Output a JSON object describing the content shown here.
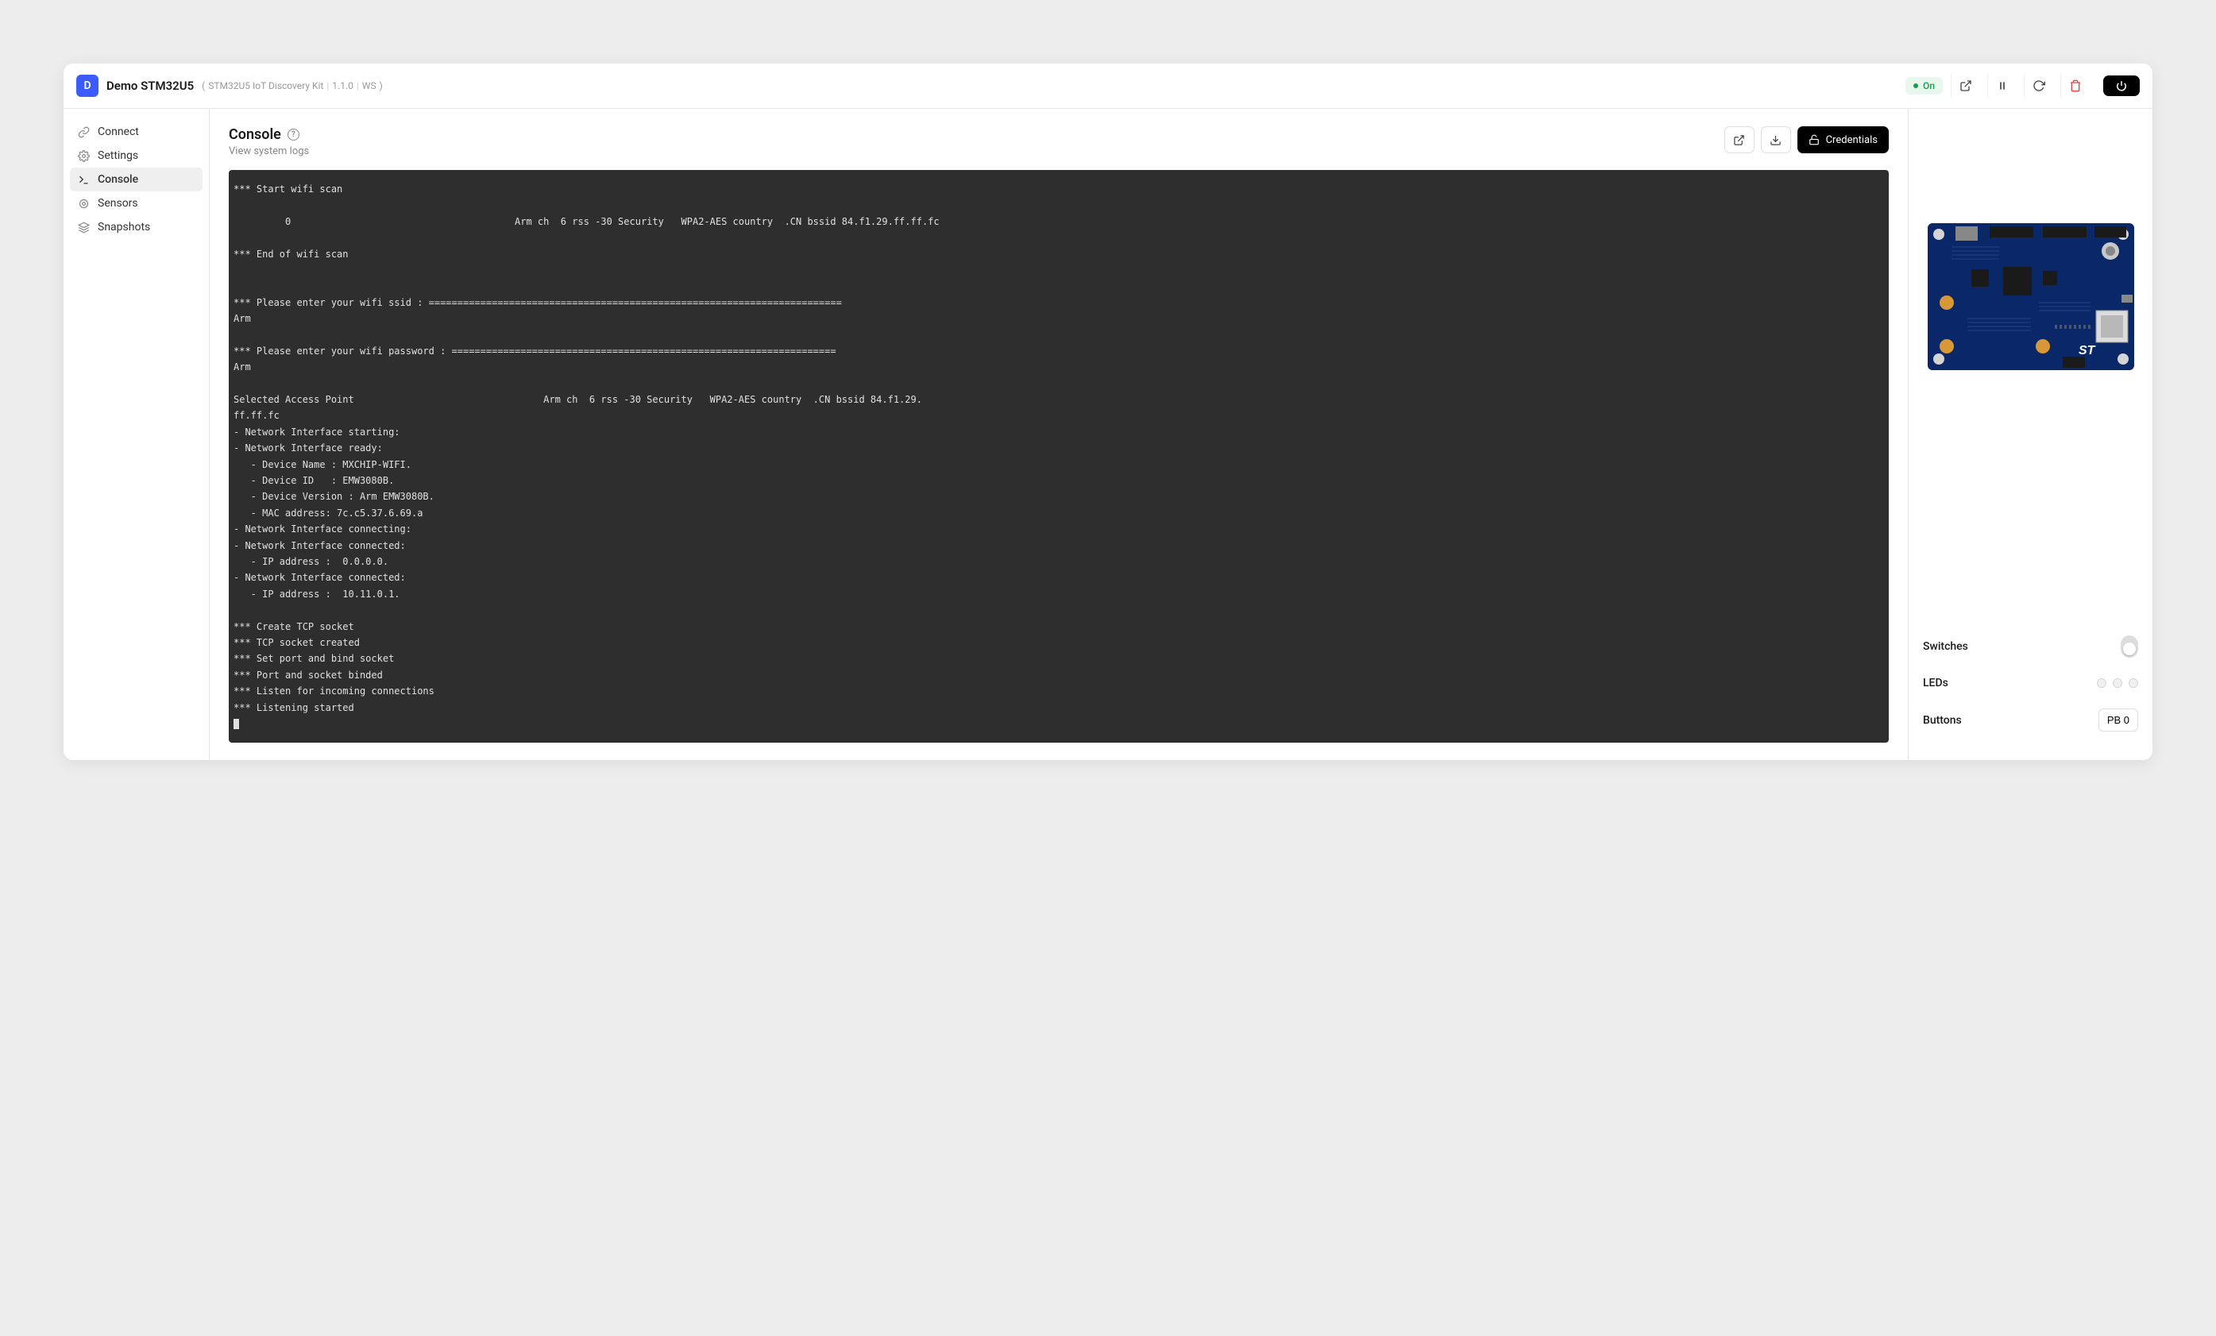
{
  "header": {
    "avatar_initial": "D",
    "title": "Demo STM32U5",
    "kit": "STM32U5 IoT Discovery Kit",
    "version": "1.1.0",
    "ws": "WS",
    "status": "On"
  },
  "sidebar": {
    "items": [
      {
        "label": "Connect"
      },
      {
        "label": "Settings"
      },
      {
        "label": "Console"
      },
      {
        "label": "Sensors"
      },
      {
        "label": "Snapshots"
      }
    ],
    "active": 2
  },
  "content": {
    "heading": "Console",
    "subheading": "View system logs",
    "credentials_label": "Credentials"
  },
  "terminal_log": "*** Start wifi scan\n\n         0                                       Arm ch  6 rss -30 Security   WPA2-AES country  .CN bssid 84.f1.29.ff.ff.fc\n\n*** End of wifi scan\n\n\n*** Please enter your wifi ssid : ========================================================================\nArm\n\n*** Please enter your wifi password : ===================================================================\nArm\n\nSelected Access Point                                 Arm ch  6 rss -30 Security   WPA2-AES country  .CN bssid 84.f1.29.\nff.ff.fc\n- Network Interface starting:\n- Network Interface ready:\n   - Device Name : MXCHIP-WIFI.\n   - Device ID   : EMW3080B.\n   - Device Version : Arm EMW3080B.\n   - MAC address: 7c.c5.37.6.69.a\n- Network Interface connecting:\n- Network Interface connected:\n   - IP address :  0.0.0.0.\n- Network Interface connected:\n   - IP address :  10.11.0.1.\n\n*** Create TCP socket\n*** TCP socket created\n*** Set port and bind socket\n*** Port and socket binded\n*** Listen for incoming connections\n*** Listening started",
  "rightpanel": {
    "switches_label": "Switches",
    "leds_label": "LEDs",
    "buttons_label": "Buttons",
    "button_name": "PB 0",
    "led_count": 3
  }
}
